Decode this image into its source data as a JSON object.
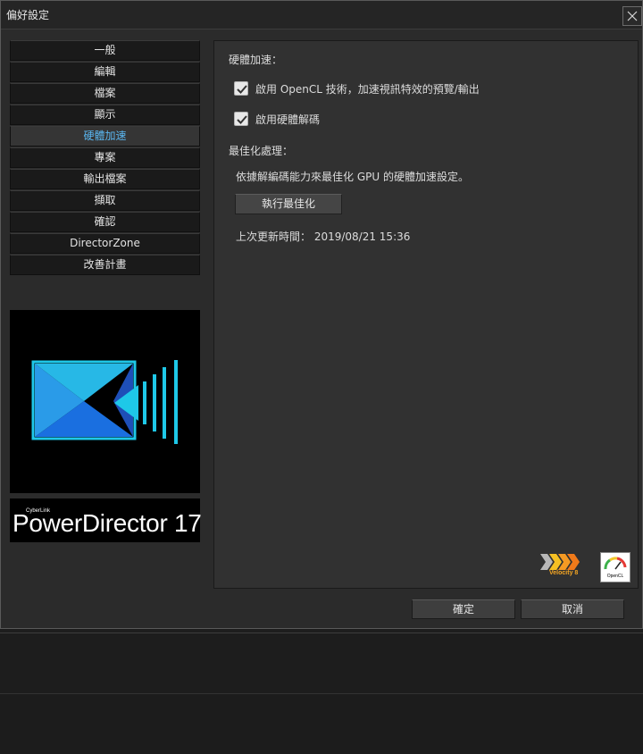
{
  "window": {
    "title": "偏好設定"
  },
  "sidebar": {
    "items": [
      {
        "label": "一般",
        "active": false
      },
      {
        "label": "編輯",
        "active": false
      },
      {
        "label": "檔案",
        "active": false
      },
      {
        "label": "顯示",
        "active": false
      },
      {
        "label": "硬體加速",
        "active": true
      },
      {
        "label": "專案",
        "active": false
      },
      {
        "label": "輸出檔案",
        "active": false
      },
      {
        "label": "擷取",
        "active": false
      },
      {
        "label": "確認",
        "active": false
      },
      {
        "label": "DirectorZone",
        "active": false
      },
      {
        "label": "改善計畫",
        "active": false
      }
    ]
  },
  "branding": {
    "company": "CyberLink",
    "product": "PowerDirector 17"
  },
  "panel": {
    "hw_section_title": "硬體加速：",
    "opencl_label": "啟用 OpenCL 技術，加速視訊特效的預覽/輸出",
    "opencl_checked": true,
    "hw_decode_label": "啟用硬體解碼",
    "hw_decode_checked": true,
    "optimize_section_title": "最佳化處理：",
    "optimize_desc": "依據解編碼能力來最佳化 GPU 的硬體加速設定。",
    "optimize_button": "執行最佳化",
    "last_update": "上次更新時間： 2019/08/21 15:36",
    "velocity_text": "Velocity 8",
    "opencl_logo_text": "OpenCL"
  },
  "footer": {
    "ok_label": "確定",
    "cancel_label": "取消"
  },
  "colors": {
    "accent": "#5ab6f0",
    "logo_cyan": "#1ec8e8",
    "logo_blue": "#1a6fe0"
  }
}
